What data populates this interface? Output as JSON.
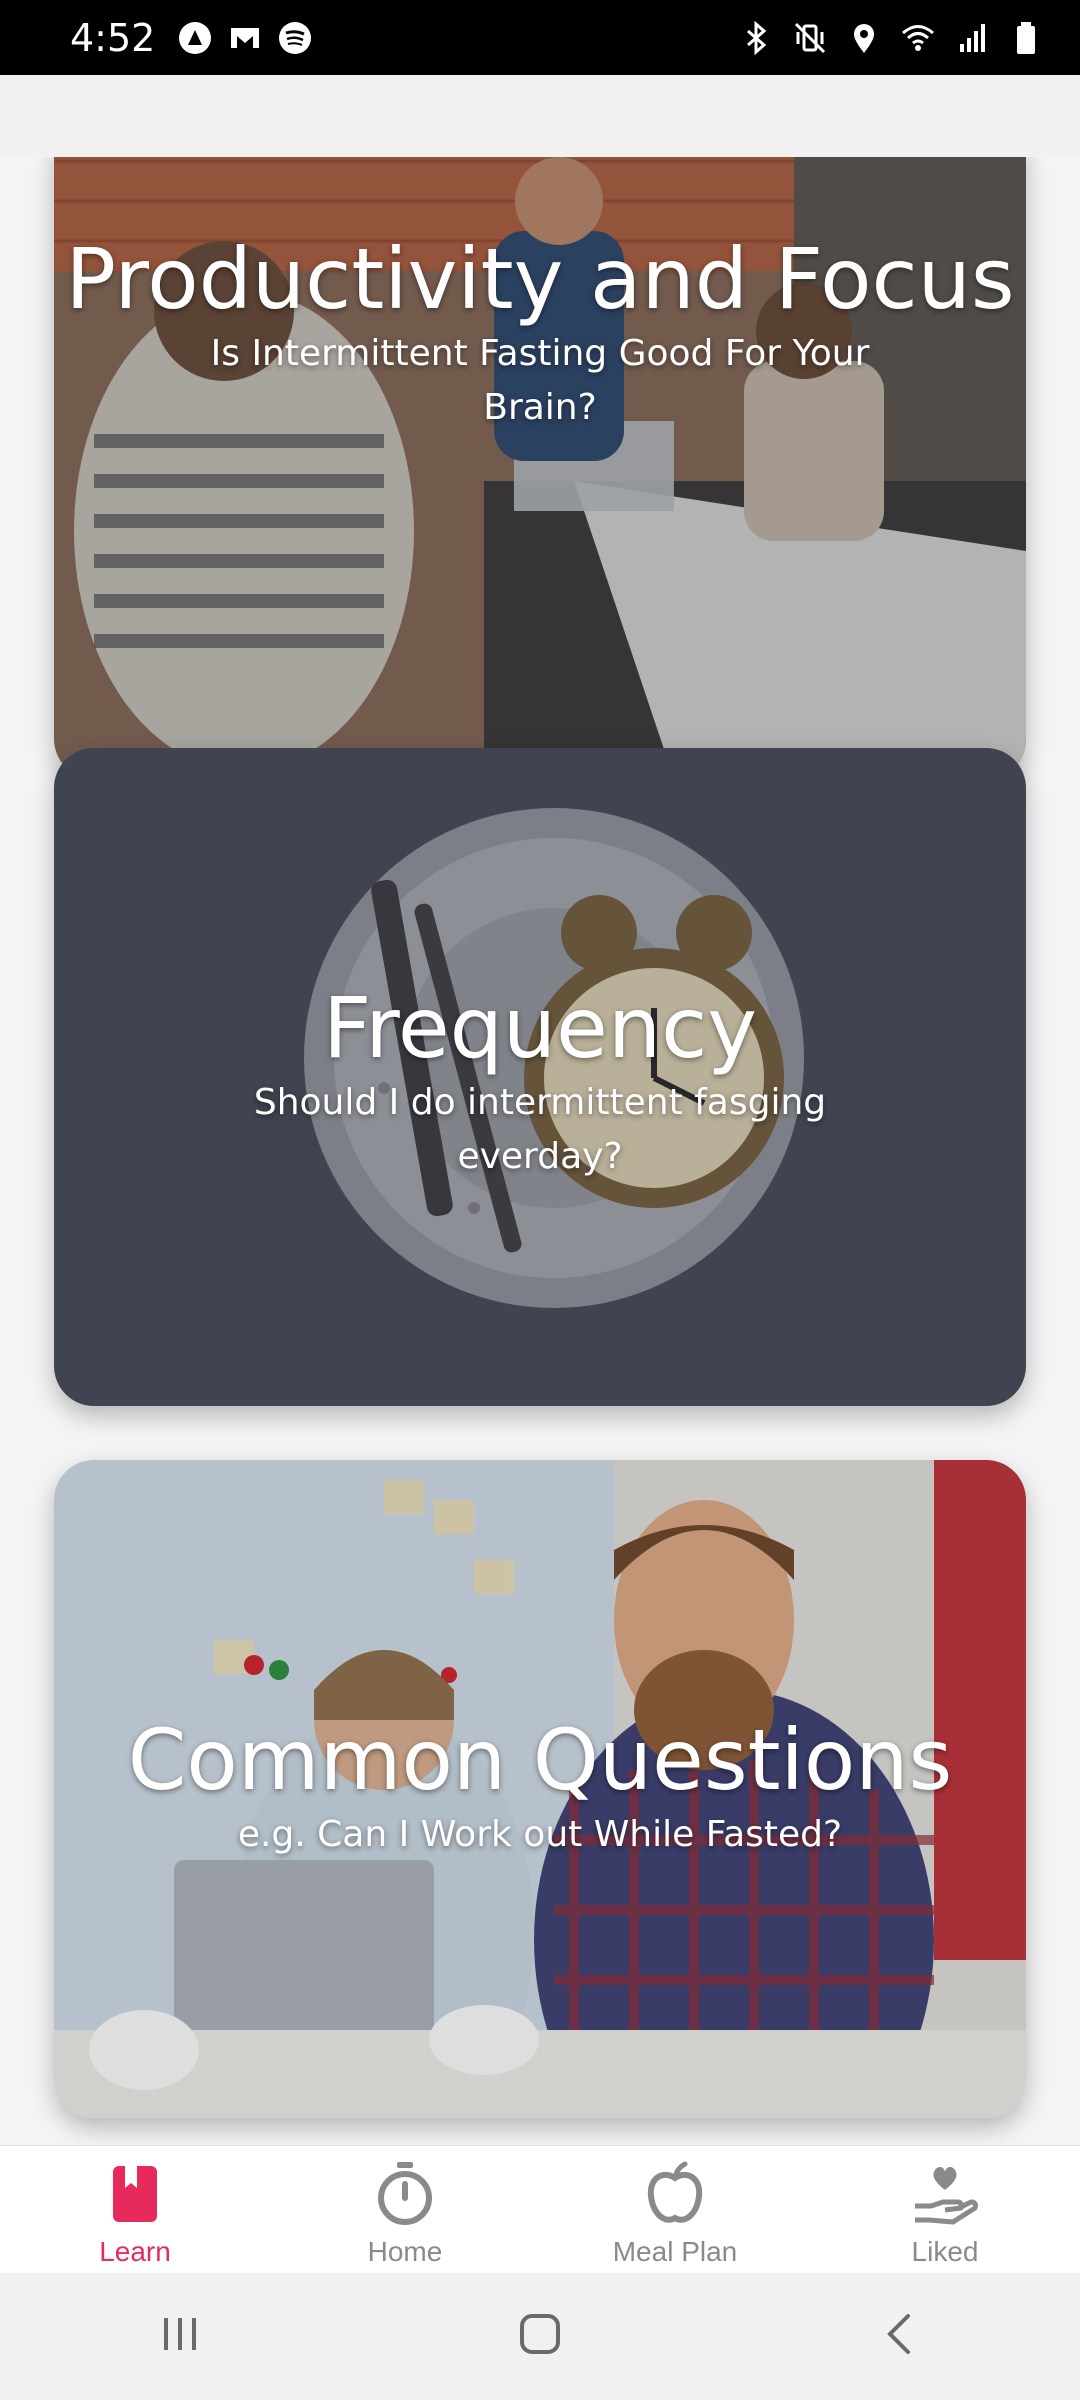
{
  "status": {
    "time": "4:52",
    "left_icons": [
      "autopilot-icon",
      "gmail-icon",
      "spotify-icon"
    ],
    "right_icons": [
      "bluetooth-icon",
      "vibrate-icon",
      "location-icon",
      "wifi-icon",
      "signal-icon",
      "battery-icon"
    ]
  },
  "cards": [
    {
      "title": "Productivity and Focus",
      "subtitle": "Is Intermittent Fasting Good For Your Brain?",
      "image": "office-team-photo"
    },
    {
      "title": "Frequency",
      "subtitle": "Should I do intermittent fasging everday?",
      "image": "clock-plate-photo"
    },
    {
      "title": "Common Questions",
      "subtitle": "e.g. Can I Work out While Fasted?",
      "image": "coworkers-cafe-photo"
    }
  ],
  "tabs": [
    {
      "label": "Learn",
      "icon": "bookmark-book-icon",
      "active": true
    },
    {
      "label": "Home",
      "icon": "stopwatch-icon",
      "active": false
    },
    {
      "label": "Meal Plan",
      "icon": "apple-icon",
      "active": false
    },
    {
      "label": "Liked",
      "icon": "heart-hand-icon",
      "active": false
    }
  ],
  "colors": {
    "accent": "#e8295b",
    "inactive": "#8a8a8a"
  }
}
